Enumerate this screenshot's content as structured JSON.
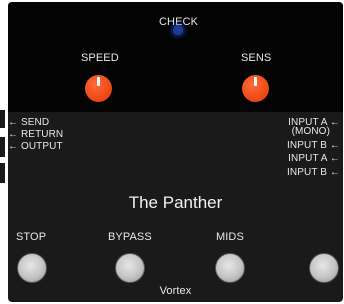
{
  "pedal": {
    "name": "The Panther",
    "brand": "Vortex",
    "indicator_label": "CHECK",
    "knobs": [
      {
        "label": "SPEED"
      },
      {
        "label": "SENS"
      }
    ],
    "left_io": [
      "← SEND",
      "← RETURN",
      "← OUTPUT"
    ],
    "right_io": [
      "INPUT A ←",
      "(MONO)",
      "INPUT B ←",
      "INPUT A ←",
      "INPUT B ←"
    ],
    "footswitches": [
      "STOP",
      "BYPASS",
      "MIDS"
    ],
    "colors": {
      "body": "#1a1a1a",
      "panel": "#030303",
      "knob": "#f04a18",
      "led": "#1d3a9a",
      "switch": "#c4c4c4"
    }
  }
}
